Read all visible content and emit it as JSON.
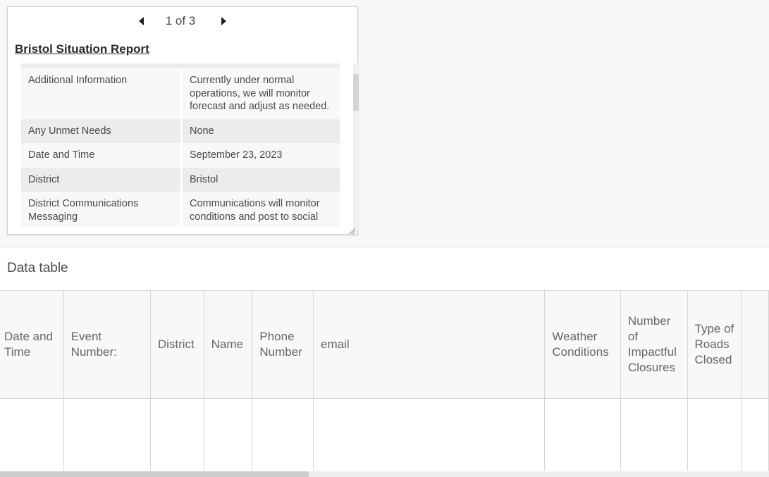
{
  "popup": {
    "pager": {
      "label": "1 of 3"
    },
    "title": "Bristol Situation Report",
    "attributes": [
      {
        "key": "Additional Information",
        "value": "Currently under normal operations, we will monitor forecast and adjust as needed."
      },
      {
        "key": "Any Unmet Needs",
        "value": "None"
      },
      {
        "key": "Date and Time",
        "value": "September 23, 2023"
      },
      {
        "key": "District",
        "value": "Bristol"
      },
      {
        "key": "District Communications Messaging",
        "value": "Communications will monitor conditions and post to social"
      }
    ]
  },
  "data_table": {
    "title": "Data table",
    "columns": [
      "Date and Time",
      "Event Number:",
      "District",
      "Name",
      "Phone Number",
      "email",
      "Weather Conditions",
      "Number of Impactful Closures",
      "Type of Roads Closed"
    ]
  },
  "icons": {
    "prev": "caret-left-icon",
    "next": "caret-right-icon",
    "resize": "resize-grip-icon"
  }
}
